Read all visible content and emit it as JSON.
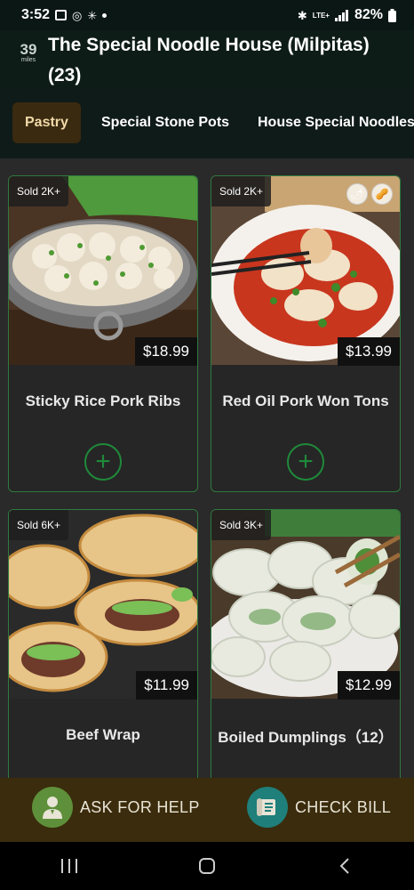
{
  "status": {
    "time": "3:52",
    "network": "LTE+",
    "battery": "82%"
  },
  "header": {
    "logo_number": "39",
    "logo_sub": "miles",
    "title": "The Special Noodle House (Milpitas) (23)"
  },
  "tabs": [
    {
      "label": "Pastry",
      "active": true
    },
    {
      "label": "Special Stone Pots",
      "active": false
    },
    {
      "label": "House Special Noodles &",
      "active": false
    }
  ],
  "items": [
    {
      "name": "Sticky Rice Pork Ribs",
      "price": "$18.99",
      "sold": "Sold 2K+",
      "add_label": "+"
    },
    {
      "name": "Red Oil Pork Won Tons",
      "price": "$13.99",
      "sold": "Sold 2K+",
      "add_label": "+",
      "badges": [
        "chili-icon",
        "peanut-icon"
      ]
    },
    {
      "name": "Beef Wrap",
      "price": "$11.99",
      "sold": "Sold 6K+"
    },
    {
      "name": "Boiled Dumplings（12）",
      "price": "$12.99",
      "sold": "Sold 3K+"
    }
  ],
  "bottom": {
    "help_label": "ASK FOR HELP",
    "bill_label": "CHECK BILL"
  },
  "colors": {
    "accent_green": "#1f8a3a",
    "active_tab_bg": "#3a2a10",
    "bottom_bar_bg": "#3a2c0c"
  }
}
